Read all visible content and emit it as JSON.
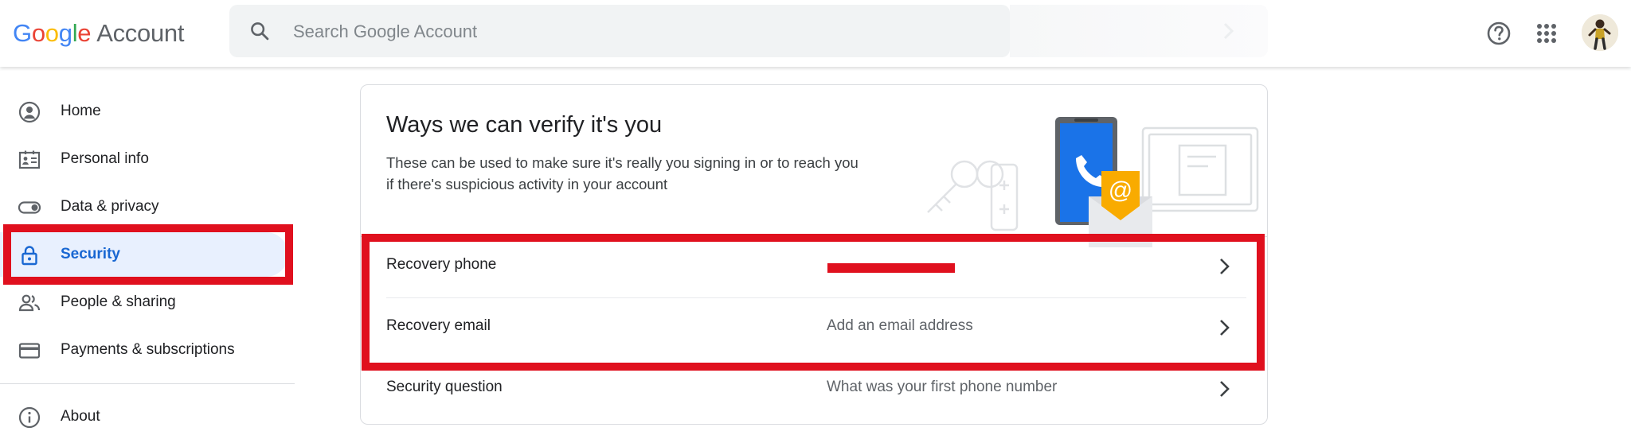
{
  "header": {
    "logo": {
      "letters": [
        {
          "char": "G",
          "color": "#4285f4"
        },
        {
          "char": "o",
          "color": "#ea4335"
        },
        {
          "char": "o",
          "color": "#fbbc05"
        },
        {
          "char": "g",
          "color": "#4285f4"
        },
        {
          "char": "l",
          "color": "#34a853"
        },
        {
          "char": "e",
          "color": "#ea4335"
        }
      ],
      "product": "Account"
    },
    "search": {
      "placeholder": "Search Google Account",
      "icon": "search-icon"
    },
    "icons": [
      "help-icon",
      "apps-grid-icon",
      "avatar"
    ]
  },
  "sidebar": {
    "items": [
      {
        "label": "Home",
        "icon": "home-person-icon",
        "active": false
      },
      {
        "label": "Personal info",
        "icon": "id-card-icon",
        "active": false
      },
      {
        "label": "Data & privacy",
        "icon": "toggle-icon",
        "active": false
      },
      {
        "label": "Security",
        "icon": "lock-icon",
        "active": true
      },
      {
        "label": "People & sharing",
        "icon": "people-icon",
        "active": false
      },
      {
        "label": "Payments & subscriptions",
        "icon": "credit-card-icon",
        "active": false
      }
    ],
    "footer_items": [
      {
        "label": "About",
        "icon": "info-icon",
        "active": false
      }
    ],
    "active_color": "#1967d2",
    "active_bg": "#e8f0fe"
  },
  "card": {
    "title": "Ways we can verify it's you",
    "description": "These can be used to make sure it's really you signing in or to reach you if there's suspicious activity in your account",
    "rows": [
      {
        "label": "Recovery phone",
        "value": "",
        "redacted": true
      },
      {
        "label": "Recovery email",
        "value": "Add an email address",
        "redacted": false
      },
      {
        "label": "Security question",
        "value": "What was your first phone number",
        "redacted": false
      }
    ]
  },
  "annotation_color": "#e0101e"
}
